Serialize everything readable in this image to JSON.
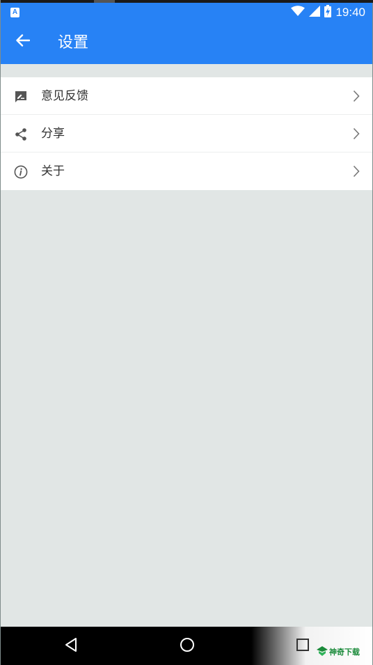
{
  "status_bar": {
    "app_icon_letter": "A",
    "time": "19:40",
    "icons": [
      "wifi-icon",
      "signal-icon",
      "battery-charging-icon"
    ]
  },
  "app_bar": {
    "back_icon": "arrow-left-icon",
    "title": "设置"
  },
  "settings": {
    "items": [
      {
        "label": "意见反馈",
        "icon": "feedback-icon"
      },
      {
        "label": "分享",
        "icon": "share-icon"
      },
      {
        "label": "关于",
        "icon": "info-icon"
      }
    ]
  },
  "nav_bar": {
    "buttons": [
      "back-triangle-icon",
      "home-circle-icon",
      "recents-square-icon"
    ]
  },
  "watermark": {
    "text": "神奇下载"
  },
  "colors": {
    "primary": "#2782f5",
    "background": "#e1e6e5",
    "list_background": "#ffffff",
    "text": "#333333",
    "icon": "#555555"
  }
}
